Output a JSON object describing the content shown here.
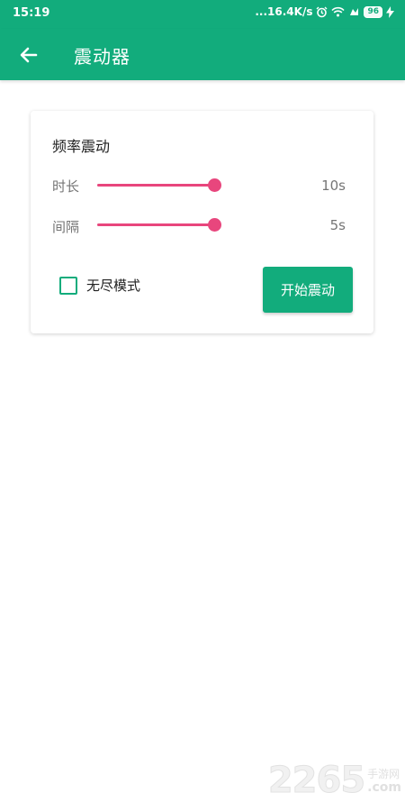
{
  "status_bar": {
    "time": "15:19",
    "network_speed": "...16.4K/s",
    "battery": "96",
    "icons": [
      "alarm-icon",
      "wifi-icon",
      "notification-icon",
      "battery-icon",
      "charging-icon"
    ]
  },
  "app_bar": {
    "title": "震动器",
    "back_icon": "arrow-left-icon"
  },
  "card": {
    "title": "频率震动",
    "duration": {
      "label": "时长",
      "value": "10s",
      "level": 1.0
    },
    "interval": {
      "label": "间隔",
      "value": "5s",
      "level": 1.0
    },
    "endless": {
      "label": "无尽模式",
      "checked": false
    },
    "start_button": "开始震动"
  },
  "watermark": {
    "number": "2265",
    "cn": "手游网",
    "domain": ".com"
  },
  "colors": {
    "primary": "#12ac7c",
    "accent": "#e8467d",
    "text_primary": "#212121",
    "text_secondary": "#757575"
  }
}
